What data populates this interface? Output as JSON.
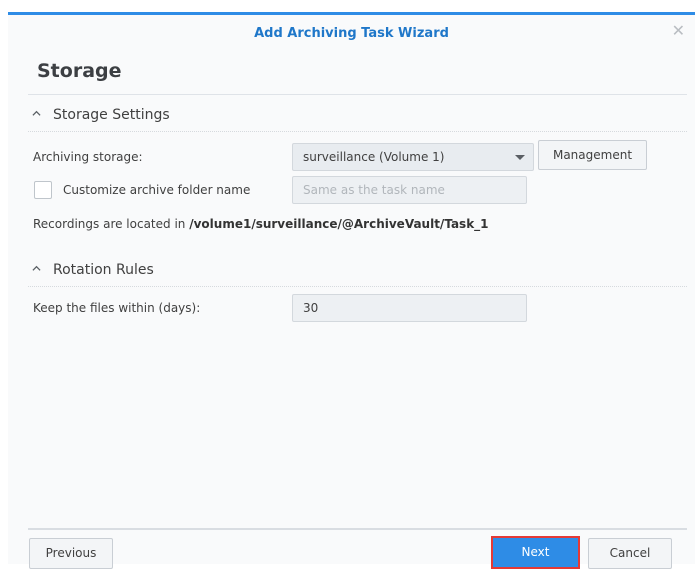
{
  "dialog": {
    "title": "Add Archiving Task Wizard",
    "page_heading": "Storage"
  },
  "storage_settings": {
    "section_label": "Storage Settings",
    "archiving_storage_label": "Archiving storage:",
    "archiving_storage_value": "surveillance (Volume 1)",
    "management_button": "Management",
    "customize_folder_label": "Customize archive folder name",
    "customize_folder_checked": false,
    "folder_name_placeholder": "Same as the task name",
    "location_prefix": "Recordings are located in ",
    "location_path": "/volume1/surveillance/@ArchiveVault/Task_1"
  },
  "rotation_rules": {
    "section_label": "Rotation Rules",
    "keep_days_label": "Keep the files within (days):",
    "keep_days_value": "30"
  },
  "footer": {
    "previous_button": "Previous",
    "next_button": "Next",
    "cancel_button": "Cancel"
  },
  "colors": {
    "accent": "#2e8ce6",
    "title_text": "#1f77c9",
    "highlight_border": "#e53935"
  }
}
